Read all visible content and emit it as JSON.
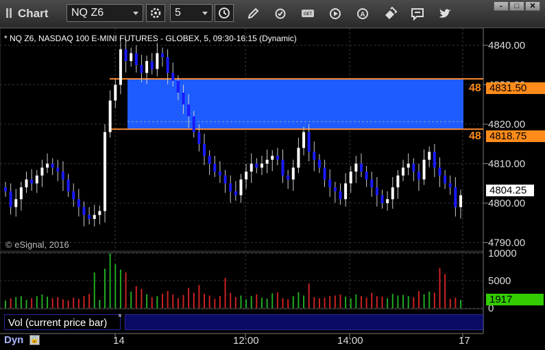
{
  "toolbar": {
    "title": "Chart",
    "symbol": "NQ Z6",
    "interval": "5",
    "icons": [
      "settings-icon",
      "clock-icon",
      "pencil-icon",
      "refresh-icon",
      "get-icon",
      "play-icon",
      "a-icon",
      "eraser-icon",
      "chat-icon",
      "twitter-icon"
    ]
  },
  "window_buttons": [
    "-",
    "□",
    "✕"
  ],
  "chart": {
    "description": "* NQ Z6, NASDAQ 100 E-MINI FUTURES - GLOBEX, 5, 09:30-16:15 (Dynamic)",
    "copyright": "© eSignal, 2016",
    "price_axis": [
      "4840.00",
      "4830.00",
      "4820.00",
      "4810.00",
      "4800.00",
      "4790.00"
    ],
    "price_tags": {
      "upper": "4831.50",
      "lower": "4818.75",
      "current": "4804.25",
      "upper_prefix": "48",
      "lower_prefix": "48"
    },
    "volume_axis": [
      "10000",
      "5000",
      "0"
    ],
    "volume_tag": "1917",
    "volume_label": "Vol (current price bar)",
    "volume_close": "×",
    "time_axis": [
      "14",
      "12:00",
      "14:00",
      "17"
    ],
    "dyn_label": "Dyn",
    "colors": {
      "up_candle": "#ffffff",
      "down_candle": "#1a1aff",
      "zone_fill": "#1e5cff",
      "zone_line": "#ff8c33",
      "volume_up": "#22aa22",
      "volume_down": "#cc2222",
      "volume_tag_bg": "#33cc00"
    }
  },
  "chart_data": {
    "type": "candlestick",
    "title": "NQ Z6",
    "ylim": [
      4788,
      4844
    ],
    "zone": [
      4818.75,
      4831.5
    ],
    "closes": [
      4803,
      4799,
      4801,
      4804,
      4806,
      4805,
      4807,
      4809,
      4810,
      4809,
      4808,
      4806,
      4803,
      4801,
      4799,
      4797,
      4796,
      4797,
      4798,
      4818,
      4826,
      4830,
      4839,
      4836,
      4838,
      4835,
      4833,
      4836,
      4834,
      4838,
      4837,
      4833,
      4831,
      4828,
      4825,
      4822,
      4818,
      4815,
      4812,
      4810,
      4808,
      4807,
      4805,
      4803,
      4802,
      4806,
      4808,
      4810,
      4809,
      4810,
      4811,
      4812,
      4811,
      4807,
      4806,
      4809,
      4814,
      4818,
      4813,
      4811,
      4809,
      4806,
      4804,
      4803,
      4801,
      4805,
      4808,
      4810,
      4808,
      4806,
      4804,
      4802,
      4800,
      4801,
      4804,
      4807,
      4809,
      4810,
      4808,
      4806,
      4811,
      4813,
      4809,
      4807,
      4805,
      4804,
      4799,
      4802
    ],
    "volumes": [
      1400,
      1800,
      2000,
      2200,
      1500,
      1800,
      2200,
      2500,
      2100,
      1800,
      2000,
      1600,
      1400,
      1900,
      1700,
      2200,
      2600,
      6500,
      1500,
      7200,
      10000,
      8000,
      7000,
      6500,
      3000,
      4000,
      3500,
      2500,
      2000,
      2200,
      2600,
      3100,
      2500,
      1800,
      2400,
      3700,
      2800,
      4200,
      2600,
      2300,
      1700,
      2200,
      5500,
      2800,
      2000,
      2300,
      1600,
      2200,
      2500,
      1900,
      1700,
      2700,
      2900,
      1800,
      1600,
      2200,
      2900,
      2300,
      4500,
      2000,
      1800,
      1900,
      2200,
      2300,
      2500,
      2100,
      1800,
      2500,
      2200,
      1900,
      2800,
      2200,
      2100,
      1800,
      2600,
      2300,
      2400,
      2200,
      2000,
      3100,
      2500,
      3000,
      2800,
      7300,
      6200,
      1700,
      1917,
      1500
    ]
  }
}
